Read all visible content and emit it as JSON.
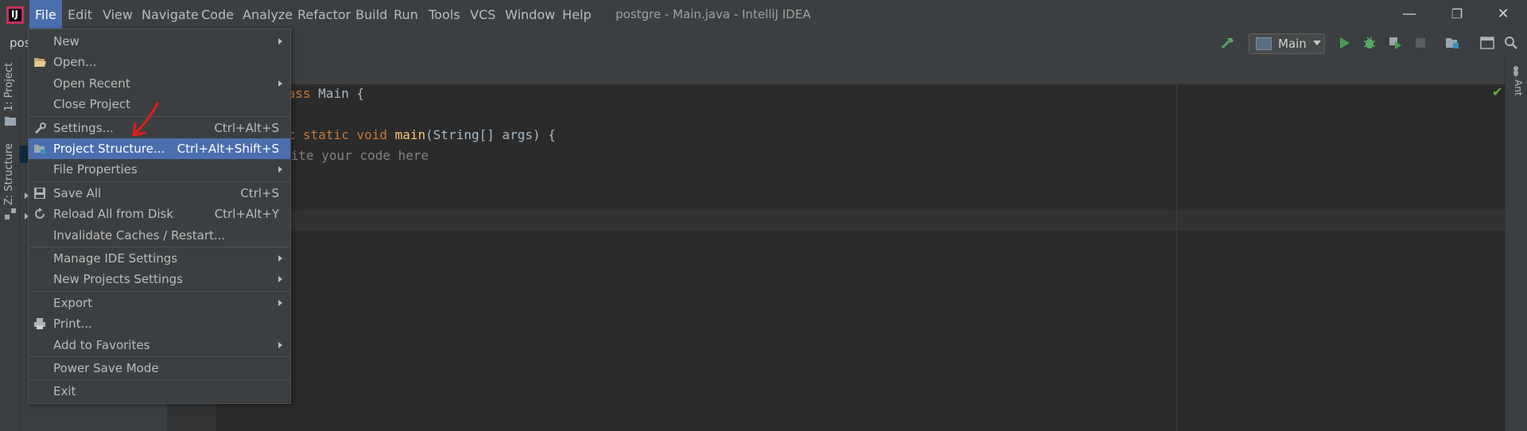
{
  "window": {
    "title": "postgre - Main.java - IntelliJ IDEA",
    "logo_text": "IJ",
    "minimize": "—",
    "restore": "❐",
    "close": "✕"
  },
  "menubar": {
    "items": [
      {
        "label": "File",
        "active": true
      },
      {
        "label": "Edit"
      },
      {
        "label": "View"
      },
      {
        "label": "Navigate"
      },
      {
        "label": "Code"
      },
      {
        "label": "Analyze"
      },
      {
        "label": "Refactor"
      },
      {
        "label": "Build"
      },
      {
        "label": "Run"
      },
      {
        "label": "Tools"
      },
      {
        "label": "VCS"
      },
      {
        "label": "Window"
      },
      {
        "label": "Help"
      }
    ]
  },
  "toolbar": {
    "project_crumb": "pos",
    "run_config": "Main",
    "icons": [
      "hammer-icon",
      "run-icon",
      "debug-icon",
      "coverage-icon",
      "stop-icon",
      "project-structure-icon",
      "window-icon",
      "search-icon"
    ]
  },
  "side_tabs": {
    "project": "1: Project",
    "structure": "Z: Structure",
    "ant": "Ant"
  },
  "editor": {
    "lines": [
      {
        "parts": [
          {
            "t": "lass ",
            "c": "kw"
          },
          {
            "t": "Main {",
            "c": "pl"
          }
        ]
      },
      {
        "parts": []
      },
      {
        "parts": [
          {
            "t": "ic static void ",
            "c": "kw"
          },
          {
            "t": "main",
            "c": "fn"
          },
          {
            "t": "(String[] args) {",
            "c": "pl"
          }
        ]
      },
      {
        "parts": [
          {
            "t": "rite your code here",
            "c": "cm"
          }
        ]
      }
    ]
  },
  "file_menu": {
    "items": [
      {
        "label": "New",
        "submenu": true
      },
      {
        "label": "Open...",
        "icon": "folder-open-icon"
      },
      {
        "label": "Open Recent",
        "submenu": true
      },
      {
        "label": "Close Project"
      },
      {
        "sep": true
      },
      {
        "label": "Settings...",
        "shortcut": "Ctrl+Alt+S",
        "icon": "wrench-icon"
      },
      {
        "label": "Project Structure...",
        "shortcut": "Ctrl+Alt+Shift+S",
        "icon": "project-structure-icon",
        "selected": true
      },
      {
        "label": "File Properties",
        "submenu": true
      },
      {
        "sep": true
      },
      {
        "label": "Save All",
        "shortcut": "Ctrl+S",
        "icon": "save-icon"
      },
      {
        "label": "Reload All from Disk",
        "shortcut": "Ctrl+Alt+Y",
        "icon": "reload-icon"
      },
      {
        "label": "Invalidate Caches / Restart..."
      },
      {
        "sep": true
      },
      {
        "label": "Manage IDE Settings",
        "submenu": true
      },
      {
        "label": "New Projects Settings",
        "submenu": true
      },
      {
        "sep": true
      },
      {
        "label": "Export",
        "submenu": true
      },
      {
        "label": "Print...",
        "icon": "print-icon"
      },
      {
        "label": "Add to Favorites",
        "submenu": true
      },
      {
        "sep": true
      },
      {
        "label": "Power Save Mode"
      },
      {
        "sep": true
      },
      {
        "label": "Exit"
      }
    ]
  },
  "colors": {
    "accent": "#4b6eaf",
    "background": "#2b2b2b",
    "panel": "#3c3f41",
    "annotation_arrow": "#e8191b"
  }
}
